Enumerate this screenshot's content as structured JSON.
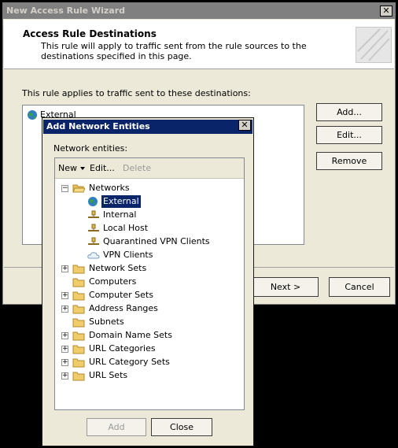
{
  "wizard": {
    "title": "New Access Rule Wizard",
    "header_title": "Access Rule Destinations",
    "header_desc": "This rule will apply to traffic sent from the rule sources to the destinations specified in this page.",
    "applies_label": "This rule applies to traffic sent to these destinations:",
    "destinations": [
      "External"
    ],
    "buttons": {
      "add": "Add...",
      "edit": "Edit...",
      "remove": "Remove",
      "next": "Next >",
      "cancel": "Cancel"
    }
  },
  "dialog": {
    "title": "Add Network Entities",
    "entities_label": "Network entities:",
    "toolbar": {
      "new": "New",
      "edit": "Edit...",
      "delete": "Delete"
    },
    "tree": {
      "networks": "Networks",
      "external": "External",
      "internal": "Internal",
      "localhost": "Local Host",
      "quarantined": "Quarantined VPN Clients",
      "vpn": "VPN Clients",
      "network_sets": "Network Sets",
      "computers": "Computers",
      "computer_sets": "Computer Sets",
      "address_ranges": "Address Ranges",
      "subnets": "Subnets",
      "domain_name_sets": "Domain Name Sets",
      "url_categories": "URL Categories",
      "url_category_sets": "URL Category Sets",
      "url_sets": "URL Sets"
    },
    "buttons": {
      "add": "Add",
      "close": "Close"
    },
    "close_x": "✕"
  },
  "colors": {
    "selection": "#0a246a",
    "window_bg": "#ece9d8",
    "title_active": "#0a246a"
  }
}
